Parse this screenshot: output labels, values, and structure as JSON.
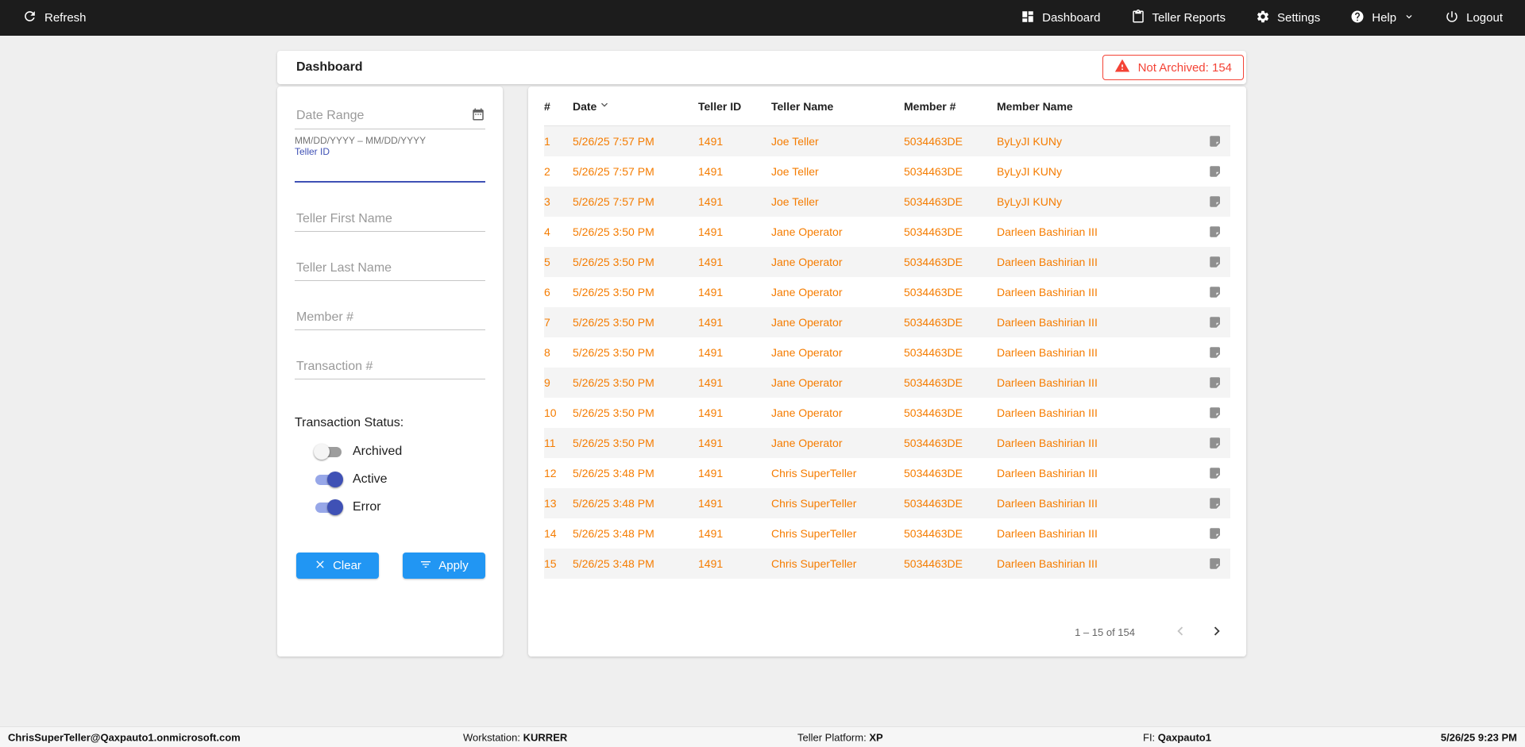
{
  "colors": {
    "topbar_bg": "#1c1c1c",
    "page_bg": "#efefef",
    "accent_orange": "#f57c00",
    "button_blue": "#2196f3",
    "primary_indigo": "#3f51b5",
    "alert_red": "#f44336"
  },
  "icons": {
    "refresh": "refresh-icon",
    "dashboard": "dashboard-icon",
    "teller_reports": "clipboard-icon",
    "settings": "gear-icon",
    "help": "help-icon",
    "help_chevron": "chevron-down-icon",
    "logout": "power-icon",
    "warning": "warning-triangle-icon",
    "calendar": "calendar-icon",
    "clear": "close-icon",
    "apply": "filter-icon",
    "sort": "sort-desc-icon",
    "note": "note-icon",
    "prev": "chevron-left-icon",
    "next": "chevron-right-icon"
  },
  "topbar": {
    "refresh_label": "Refresh",
    "nav": [
      {
        "label": "Dashboard"
      },
      {
        "label": "Teller Reports"
      },
      {
        "label": "Settings"
      },
      {
        "label": "Help"
      },
      {
        "label": "Logout"
      }
    ]
  },
  "header": {
    "title": "Dashboard",
    "not_archived_label": "Not Archived: 154"
  },
  "filters": {
    "date_range": {
      "placeholder": "Date Range",
      "helper": "MM/DD/YYYY – MM/DD/YYYY"
    },
    "teller_id": {
      "label": "Teller ID",
      "value": ""
    },
    "fields": [
      {
        "placeholder": "Teller First Name"
      },
      {
        "placeholder": "Teller Last Name"
      },
      {
        "placeholder": "Member #"
      },
      {
        "placeholder": "Transaction #"
      }
    ],
    "status_label": "Transaction Status:",
    "toggles": [
      {
        "label": "Archived",
        "on": false
      },
      {
        "label": "Active",
        "on": true
      },
      {
        "label": "Error",
        "on": true
      }
    ],
    "clear_label": "Clear",
    "apply_label": "Apply"
  },
  "table": {
    "columns": [
      "#",
      "Date",
      "Teller ID",
      "Teller Name",
      "Member #",
      "Member Name"
    ],
    "rows": [
      {
        "num": "1",
        "date": "5/26/25 7:57 PM",
        "teller_id": "1491",
        "teller_name": "Joe Teller",
        "member_num": "5034463DE",
        "member_name": "ByLyJI KUNy"
      },
      {
        "num": "2",
        "date": "5/26/25 7:57 PM",
        "teller_id": "1491",
        "teller_name": "Joe Teller",
        "member_num": "5034463DE",
        "member_name": "ByLyJI KUNy"
      },
      {
        "num": "3",
        "date": "5/26/25 7:57 PM",
        "teller_id": "1491",
        "teller_name": "Joe Teller",
        "member_num": "5034463DE",
        "member_name": "ByLyJI KUNy"
      },
      {
        "num": "4",
        "date": "5/26/25 3:50 PM",
        "teller_id": "1491",
        "teller_name": "Jane Operator",
        "member_num": "5034463DE",
        "member_name": "Darleen Bashirian III"
      },
      {
        "num": "5",
        "date": "5/26/25 3:50 PM",
        "teller_id": "1491",
        "teller_name": "Jane Operator",
        "member_num": "5034463DE",
        "member_name": "Darleen Bashirian III"
      },
      {
        "num": "6",
        "date": "5/26/25 3:50 PM",
        "teller_id": "1491",
        "teller_name": "Jane Operator",
        "member_num": "5034463DE",
        "member_name": "Darleen Bashirian III"
      },
      {
        "num": "7",
        "date": "5/26/25 3:50 PM",
        "teller_id": "1491",
        "teller_name": "Jane Operator",
        "member_num": "5034463DE",
        "member_name": "Darleen Bashirian III"
      },
      {
        "num": "8",
        "date": "5/26/25 3:50 PM",
        "teller_id": "1491",
        "teller_name": "Jane Operator",
        "member_num": "5034463DE",
        "member_name": "Darleen Bashirian III"
      },
      {
        "num": "9",
        "date": "5/26/25 3:50 PM",
        "teller_id": "1491",
        "teller_name": "Jane Operator",
        "member_num": "5034463DE",
        "member_name": "Darleen Bashirian III"
      },
      {
        "num": "10",
        "date": "5/26/25 3:50 PM",
        "teller_id": "1491",
        "teller_name": "Jane Operator",
        "member_num": "5034463DE",
        "member_name": "Darleen Bashirian III"
      },
      {
        "num": "11",
        "date": "5/26/25 3:50 PM",
        "teller_id": "1491",
        "teller_name": "Jane Operator",
        "member_num": "5034463DE",
        "member_name": "Darleen Bashirian III"
      },
      {
        "num": "12",
        "date": "5/26/25 3:48 PM",
        "teller_id": "1491",
        "teller_name": "Chris SuperTeller",
        "member_num": "5034463DE",
        "member_name": "Darleen Bashirian III"
      },
      {
        "num": "13",
        "date": "5/26/25 3:48 PM",
        "teller_id": "1491",
        "teller_name": "Chris SuperTeller",
        "member_num": "5034463DE",
        "member_name": "Darleen Bashirian III"
      },
      {
        "num": "14",
        "date": "5/26/25 3:48 PM",
        "teller_id": "1491",
        "teller_name": "Chris SuperTeller",
        "member_num": "5034463DE",
        "member_name": "Darleen Bashirian III"
      },
      {
        "num": "15",
        "date": "5/26/25 3:48 PM",
        "teller_id": "1491",
        "teller_name": "Chris SuperTeller",
        "member_num": "5034463DE",
        "member_name": "Darleen Bashirian III"
      }
    ],
    "pagination": {
      "label": "1 – 15 of 154"
    }
  },
  "footer": {
    "user": "ChrisSuperTeller@Qaxpauto1.onmicrosoft.com",
    "workstation_label": "Workstation:",
    "workstation_value": "KURRER",
    "platform_label": "Teller Platform:",
    "platform_value": "XP",
    "fi_label": "FI:",
    "fi_value": "Qaxpauto1",
    "timestamp": "5/26/25 9:23 PM"
  }
}
